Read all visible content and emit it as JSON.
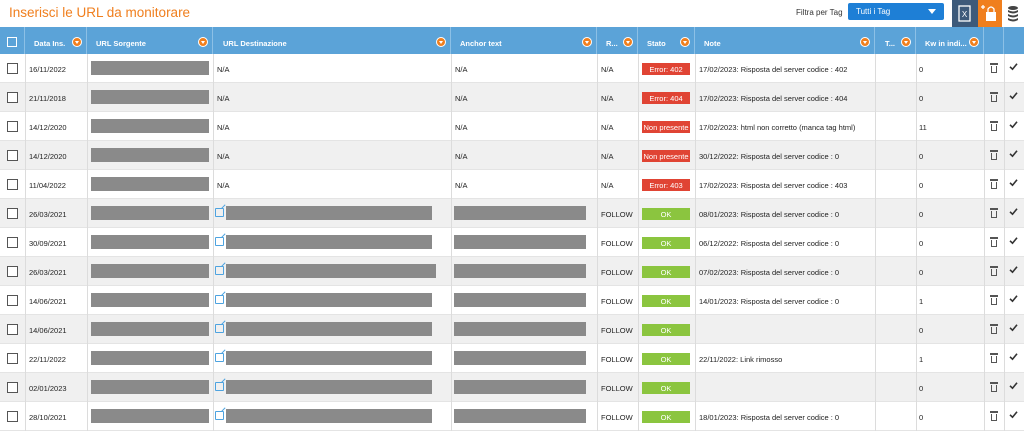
{
  "header": {
    "title": "Inserisci le URL da monitorare",
    "filter_label": "Filtra per Tag",
    "tag_select_value": "Tutti i Tag"
  },
  "toolbar_icons": [
    "excel-export-icon",
    "add-url-icon",
    "database-icon"
  ],
  "columns": [
    "Data Ins.",
    "URL Sorgente",
    "URL Destinazione",
    "Anchor text",
    "R...",
    "Stato",
    "Note",
    "T...",
    "Kw in indi..."
  ],
  "rows": [
    {
      "date": "16/11/2022",
      "dest": "N/A",
      "anchor": "N/A",
      "rel": "N/A",
      "status": "Error: 402",
      "status_type": "err",
      "note": "17/02/2023: Risposta del server codice : 402",
      "kw": "0"
    },
    {
      "date": "21/11/2018",
      "dest": "N/A",
      "anchor": "N/A",
      "rel": "N/A",
      "status": "Error: 404",
      "status_type": "err",
      "note": "17/02/2023: Risposta del server codice : 404",
      "kw": "0"
    },
    {
      "date": "14/12/2020",
      "dest": "N/A",
      "anchor": "N/A",
      "rel": "N/A",
      "status": "Non presente",
      "status_type": "err",
      "note": "17/02/2023: html non corretto (manca tag html)",
      "kw": "11"
    },
    {
      "date": "14/12/2020",
      "dest": "N/A",
      "anchor": "N/A",
      "rel": "N/A",
      "status": "Non presente",
      "status_type": "err",
      "note": "30/12/2022: Risposta del server codice : 0",
      "kw": "0"
    },
    {
      "date": "11/04/2022",
      "dest": "N/A",
      "anchor": "N/A",
      "rel": "N/A",
      "status": "Error: 403",
      "status_type": "err",
      "note": "17/02/2023: Risposta del server codice : 403",
      "kw": "0"
    },
    {
      "date": "26/03/2021",
      "dest": "",
      "anchor": "",
      "rel": "FOLLOW",
      "status": "OK",
      "status_type": "ok",
      "note": "08/01/2023: Risposta del server codice : 0",
      "kw": "0"
    },
    {
      "date": "30/09/2021",
      "dest": "",
      "anchor": "",
      "rel": "FOLLOW",
      "status": "OK",
      "status_type": "ok",
      "note": "06/12/2022: Risposta del server codice : 0",
      "kw": "0"
    },
    {
      "date": "26/03/2021",
      "dest": "",
      "anchor": "",
      "rel": "FOLLOW",
      "status": "OK",
      "status_type": "ok",
      "note": "07/02/2023: Risposta del server codice : 0",
      "kw": "0"
    },
    {
      "date": "14/06/2021",
      "dest": "",
      "anchor": "",
      "rel": "FOLLOW",
      "status": "OK",
      "status_type": "ok",
      "note": "14/01/2023: Risposta del server codice : 0",
      "kw": "1"
    },
    {
      "date": "14/06/2021",
      "dest": "",
      "anchor": "",
      "rel": "FOLLOW",
      "status": "OK",
      "status_type": "ok",
      "note": "",
      "kw": "0"
    },
    {
      "date": "22/11/2022",
      "dest": "",
      "anchor": "",
      "rel": "FOLLOW",
      "status": "OK",
      "status_type": "ok",
      "note": "22/11/2022: Link rimosso",
      "kw": "1"
    },
    {
      "date": "02/01/2023",
      "dest": "",
      "anchor": "",
      "rel": "FOLLOW",
      "status": "OK",
      "status_type": "ok",
      "note": "",
      "kw": "0"
    },
    {
      "date": "28/10/2021",
      "dest": "",
      "anchor": "",
      "rel": "FOLLOW",
      "status": "OK",
      "status_type": "ok",
      "note": "18/01/2023: Risposta del server codice : 0",
      "kw": "0"
    }
  ]
}
